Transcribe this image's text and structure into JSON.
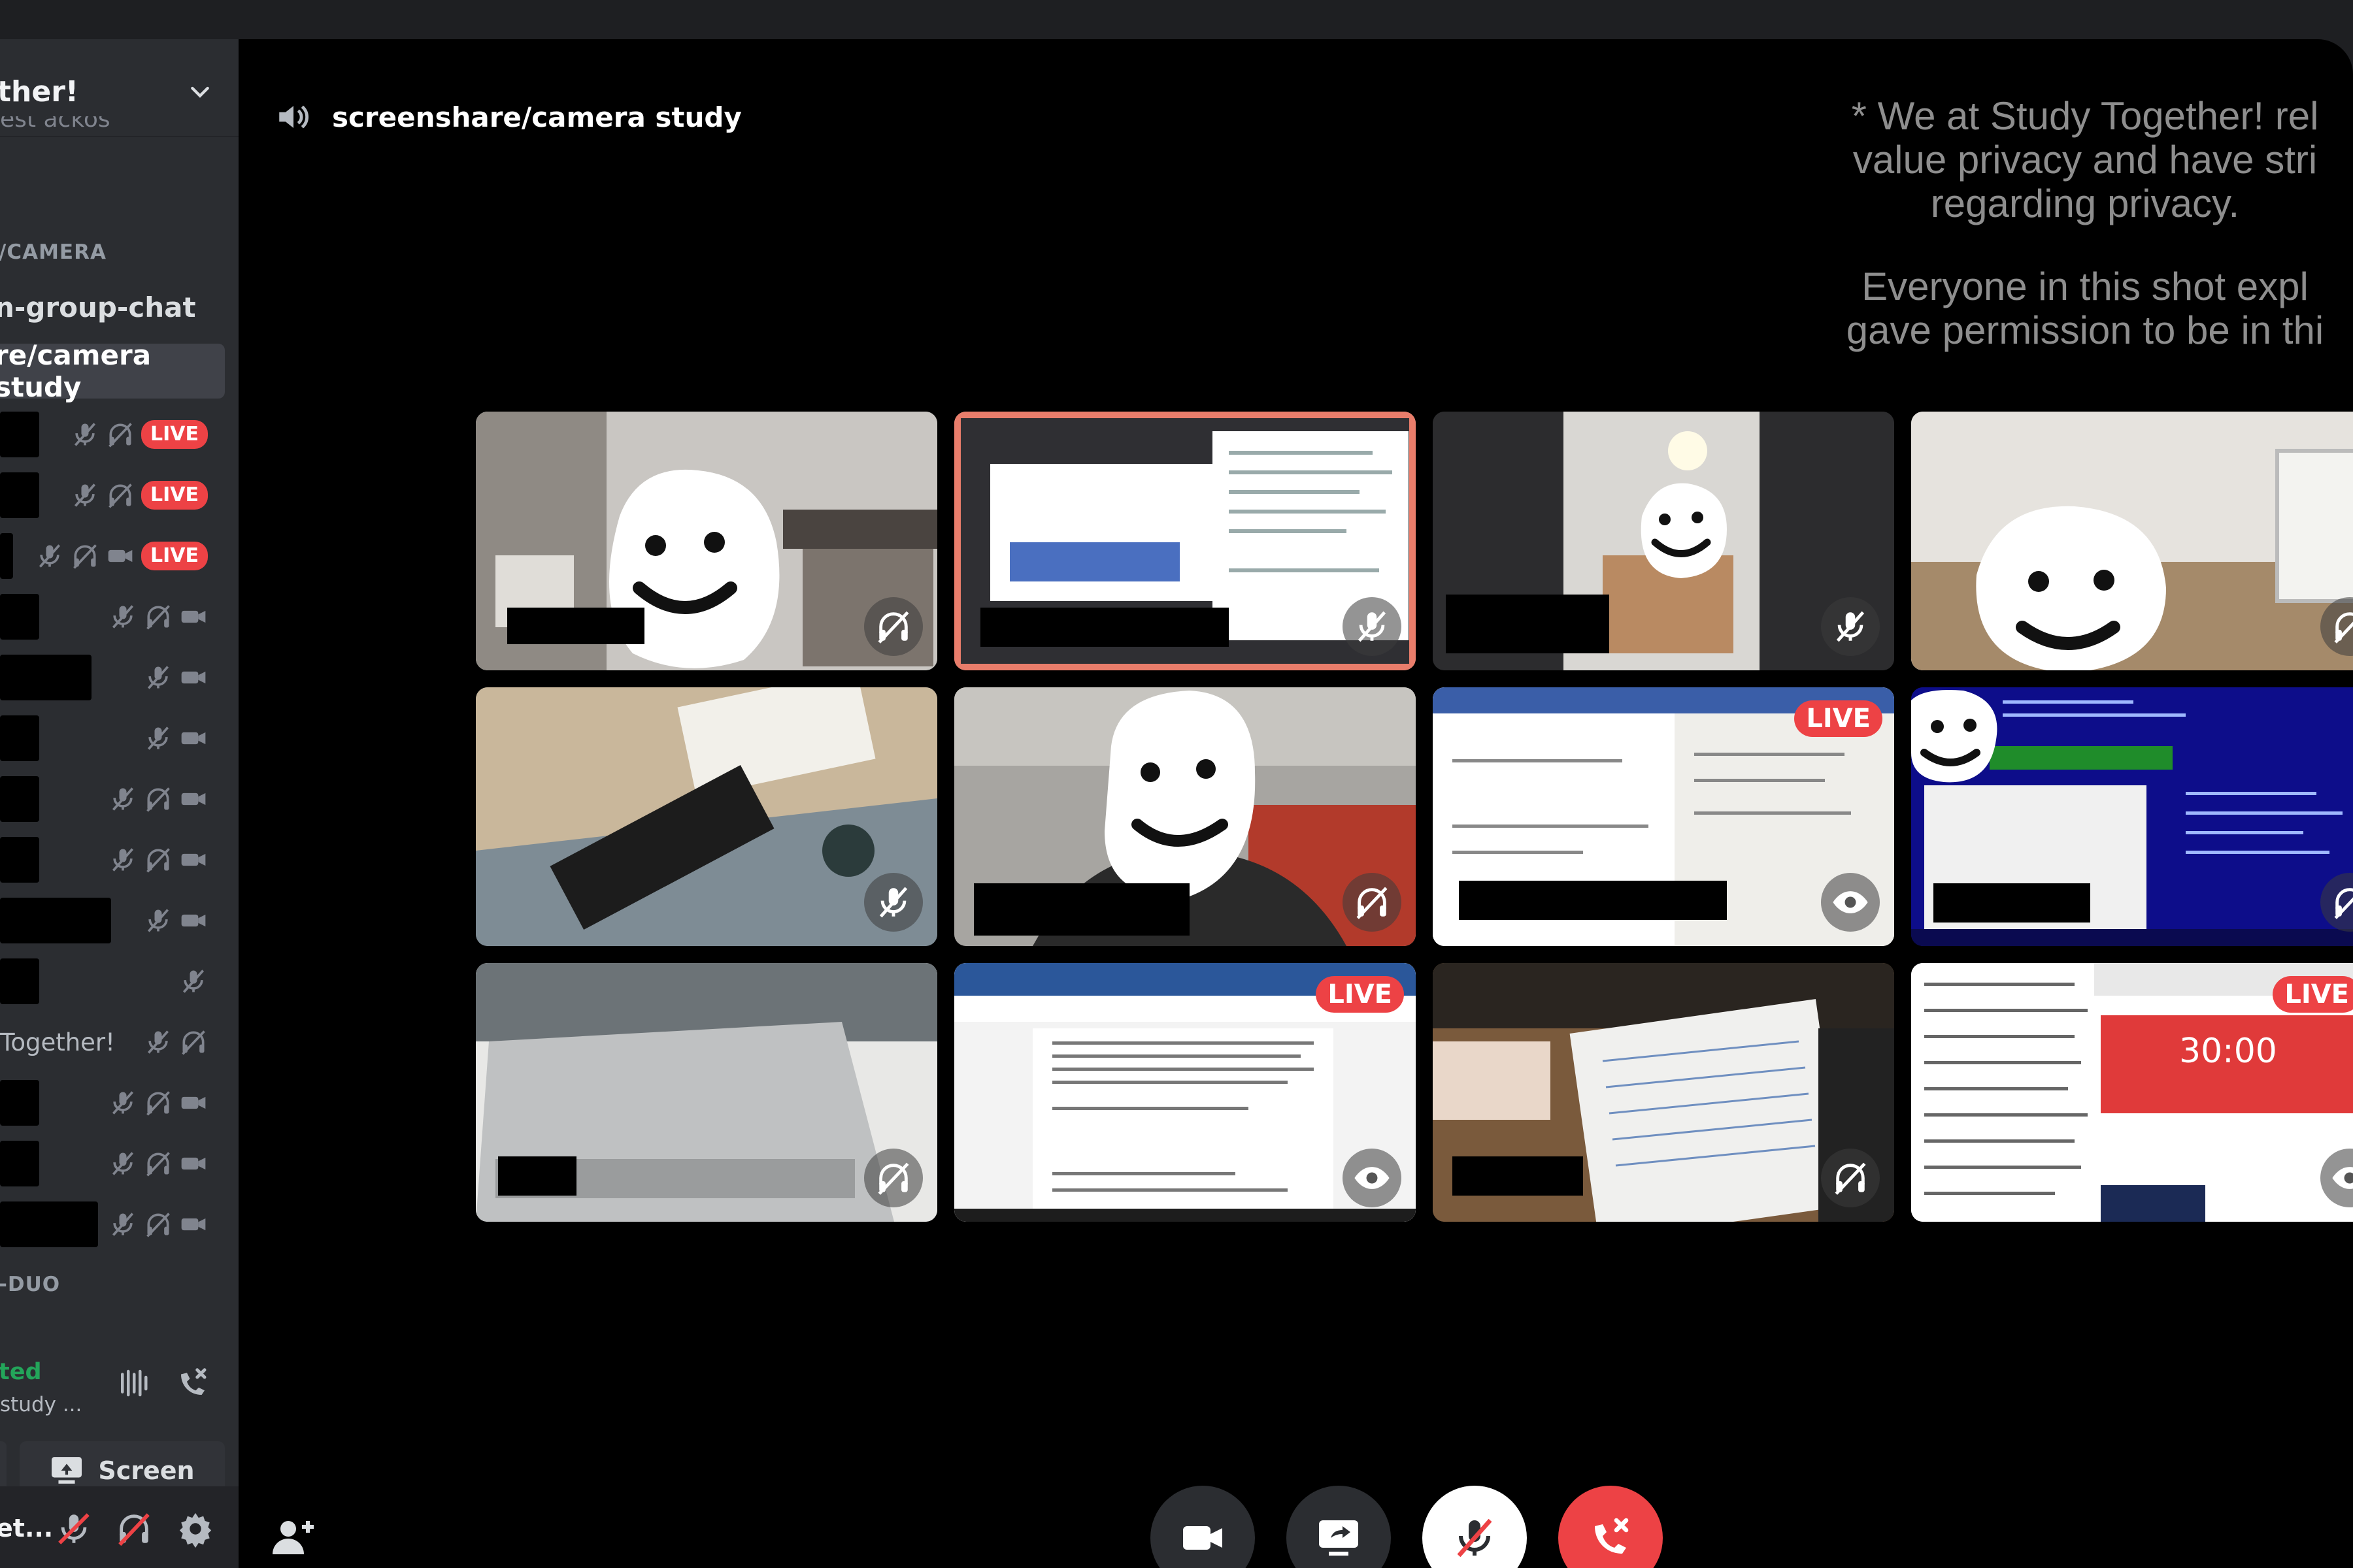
{
  "sidebar": {
    "server_name": "ther!",
    "cut_text": "est ackos",
    "category_camera": "/CAMERA",
    "channels": [
      {
        "label": "n-group-chat",
        "active": false
      },
      {
        "label": "re/camera study",
        "active": true
      }
    ],
    "voice_users": [
      {
        "text": "",
        "mute": true,
        "deafen": true,
        "camera": false,
        "live": "LIVE"
      },
      {
        "text": "",
        "mute": true,
        "deafen": true,
        "camera": false,
        "live": "LIVE"
      },
      {
        "text": "",
        "mute": true,
        "deafen": true,
        "camera": true,
        "live": "LIVE"
      },
      {
        "text": "",
        "mute": true,
        "deafen": true,
        "camera": true,
        "live": ""
      },
      {
        "text": "",
        "mute": true,
        "deafen": false,
        "camera": true,
        "live": ""
      },
      {
        "text": "",
        "mute": true,
        "deafen": false,
        "camera": true,
        "live": ""
      },
      {
        "text": "",
        "mute": true,
        "deafen": true,
        "camera": true,
        "live": ""
      },
      {
        "text": "",
        "mute": true,
        "deafen": true,
        "camera": true,
        "live": ""
      },
      {
        "text": "",
        "mute": true,
        "deafen": false,
        "camera": true,
        "live": ""
      },
      {
        "text": "",
        "mute": true,
        "deafen": false,
        "camera": false,
        "live": ""
      },
      {
        "text": "Together!",
        "mute": true,
        "deafen": true,
        "camera": false,
        "live": ""
      },
      {
        "text": "",
        "mute": true,
        "deafen": true,
        "camera": true,
        "live": ""
      },
      {
        "text": "",
        "mute": true,
        "deafen": true,
        "camera": true,
        "live": ""
      },
      {
        "text": "",
        "mute": true,
        "deafen": true,
        "camera": true,
        "live": ""
      }
    ],
    "category_duo": "-DUO",
    "voice_status": "ted",
    "voice_channel": "study ...",
    "screen_label": "Screen",
    "username": "et..."
  },
  "header": {
    "channel_name": "screenshare/camera study"
  },
  "notice": {
    "line1": "* We at Study Together! rel",
    "line2": "value privacy and have stri",
    "line3": "regarding privacy.",
    "line4": "Everyone in this shot expl",
    "line5": "gave permission to be in thi"
  },
  "tiles": [
    {
      "indicator": "deafen-icon",
      "live": ""
    },
    {
      "indicator": "mute-icon",
      "live": ""
    },
    {
      "indicator": "mute-icon",
      "live": ""
    },
    {
      "indicator": "deafen-icon",
      "live": ""
    },
    {
      "indicator": "mute-icon",
      "live": ""
    },
    {
      "indicator": "deafen-icon",
      "live": ""
    },
    {
      "indicator": "eye-icon",
      "live": "LIVE"
    },
    {
      "indicator": "deafen-icon",
      "live": ""
    },
    {
      "indicator": "deafen-icon",
      "live": ""
    },
    {
      "indicator": "eye-icon",
      "live": "LIVE"
    },
    {
      "indicator": "deafen-icon",
      "live": ""
    },
    {
      "indicator": "eye-icon",
      "live": "LIVE"
    }
  ],
  "timer": "30:00",
  "colors": {
    "live_red": "#ed4245",
    "voice_green": "#23a55a",
    "sidebar_bg": "#2b2d31",
    "main_bg": "#000000"
  },
  "controls": [
    {
      "name": "camera-button",
      "icon": "camera-icon"
    },
    {
      "name": "screenshare-button",
      "icon": "screenshare-icon"
    },
    {
      "name": "mute-button",
      "icon": "mic-muted-icon"
    },
    {
      "name": "disconnect-button",
      "icon": "phone-disconnect-icon"
    }
  ]
}
